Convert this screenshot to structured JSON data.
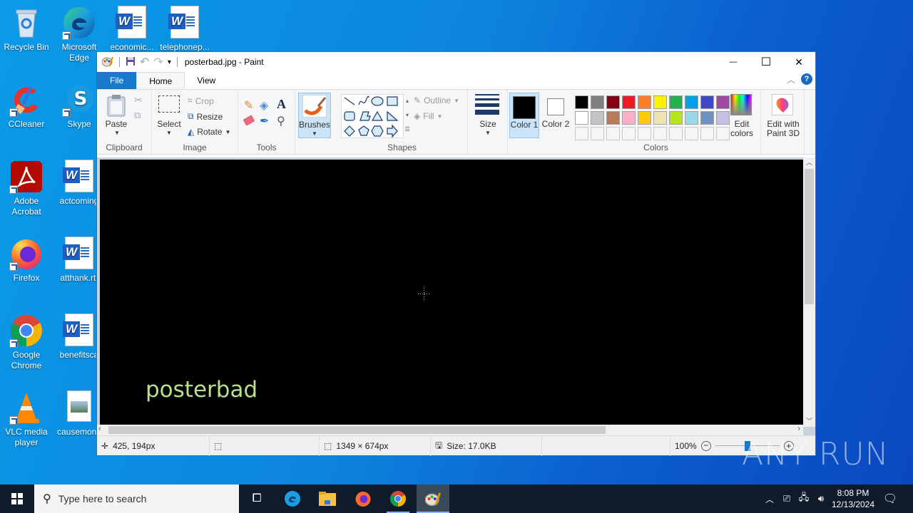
{
  "desktop": {
    "icons": [
      {
        "label": "Recycle Bin"
      },
      {
        "label": "Microsoft Edge"
      },
      {
        "label": "economic..."
      },
      {
        "label": "telephonep..."
      },
      {
        "label": "CCleaner"
      },
      {
        "label": "Skype"
      },
      {
        "label": "Adobe Acrobat"
      },
      {
        "label": "actcoming"
      },
      {
        "label": "Firefox"
      },
      {
        "label": "atthank.rtf"
      },
      {
        "label": "Google Chrome"
      },
      {
        "label": "benefitsca"
      },
      {
        "label": "VLC media player"
      },
      {
        "label": "causemone"
      }
    ]
  },
  "window": {
    "title": "posterbad.jpg - Paint",
    "controls": {
      "minimize": "—",
      "maximize": "☐",
      "close": "✕"
    },
    "tabs": [
      {
        "label": "File"
      },
      {
        "label": "Home"
      },
      {
        "label": "View"
      }
    ],
    "help": "?"
  },
  "ribbon": {
    "clipboard": {
      "label": "Clipboard",
      "paste": "Paste"
    },
    "image": {
      "label": "Image",
      "select": "Select",
      "crop": "Crop",
      "resize": "Resize",
      "rotate": "Rotate"
    },
    "tools": {
      "label": "Tools"
    },
    "brushes": {
      "label": "Brushes"
    },
    "shapes": {
      "label": "Shapes",
      "outline": "Outline",
      "fill": "Fill"
    },
    "size": {
      "label": "Size"
    },
    "colors": {
      "label": "Colors",
      "color1": "Color 1",
      "color2": "Color 2",
      "color1_value": "#000000",
      "color2_value": "#ffffff",
      "palette_row1": [
        "#000000",
        "#7f7f7f",
        "#880015",
        "#ed1c24",
        "#ff7f27",
        "#fff200",
        "#22b14c",
        "#00a2e8",
        "#3f48cc",
        "#a349a4"
      ],
      "palette_row2": [
        "#ffffff",
        "#c3c3c3",
        "#b97a57",
        "#ffaec9",
        "#ffc90e",
        "#efe4b0",
        "#b5e61d",
        "#99d9ea",
        "#7092be",
        "#c8bfe7"
      ],
      "edit_colors": "Edit colors"
    },
    "paint3d": {
      "label": "Edit with Paint 3D"
    }
  },
  "canvas": {
    "text": "posterbad",
    "text_color": "#b6e08a",
    "background": "#000000"
  },
  "statusbar": {
    "cursor_pos": "425, 194px",
    "image_size": "1349 × 674px",
    "file_size": "Size: 17.0KB",
    "zoom": "100%",
    "zoom_level": 0.5
  },
  "taskbar": {
    "search_placeholder": "Type here to search",
    "time": "8:08 PM",
    "date": "12/13/2024"
  },
  "watermark": "ANY RUN"
}
